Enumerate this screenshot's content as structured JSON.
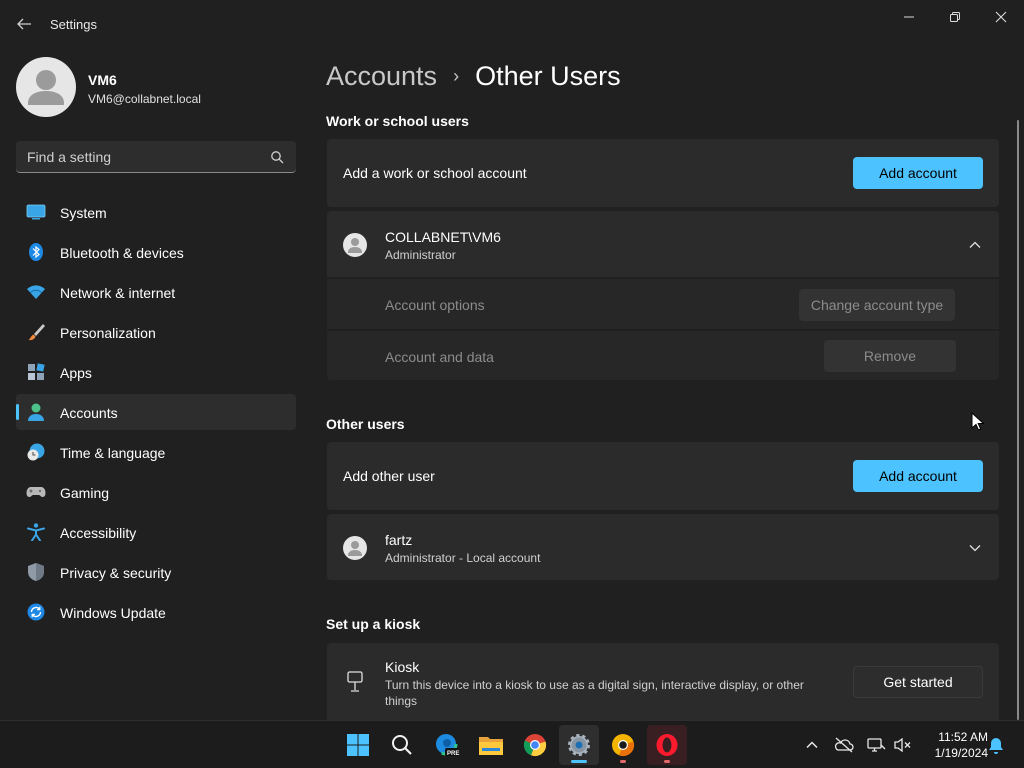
{
  "window": {
    "title": "Settings"
  },
  "profile": {
    "name": "VM6",
    "email": "VM6@collabnet.local"
  },
  "search": {
    "placeholder": "Find a setting"
  },
  "nav": {
    "items": [
      {
        "label": "System",
        "icon": "system-icon"
      },
      {
        "label": "Bluetooth & devices",
        "icon": "bluetooth-icon"
      },
      {
        "label": "Network & internet",
        "icon": "wifi-icon"
      },
      {
        "label": "Personalization",
        "icon": "brush-icon"
      },
      {
        "label": "Apps",
        "icon": "apps-icon"
      },
      {
        "label": "Accounts",
        "icon": "accounts-icon",
        "active": true
      },
      {
        "label": "Time & language",
        "icon": "globe-clock-icon"
      },
      {
        "label": "Gaming",
        "icon": "controller-icon"
      },
      {
        "label": "Accessibility",
        "icon": "accessibility-icon"
      },
      {
        "label": "Privacy & security",
        "icon": "shield-icon"
      },
      {
        "label": "Windows Update",
        "icon": "update-icon"
      }
    ]
  },
  "breadcrumb": {
    "parent": "Accounts",
    "separator": "›",
    "current": "Other Users"
  },
  "work_school": {
    "heading": "Work or school users",
    "add_label": "Add a work or school account",
    "add_button": "Add account",
    "user": {
      "name": "COLLABNET\\VM6",
      "role": "Administrator",
      "expanded": true
    },
    "options": {
      "account_options_label": "Account options",
      "change_type_button": "Change account type",
      "account_data_label": "Account and data",
      "remove_button": "Remove"
    }
  },
  "other_users": {
    "heading": "Other users",
    "add_label": "Add other user",
    "add_button": "Add account",
    "user": {
      "name": "fartz",
      "role": "Administrator - Local account",
      "expanded": false
    }
  },
  "kiosk": {
    "heading": "Set up a kiosk",
    "title": "Kiosk",
    "description": "Turn this device into a kiosk to use as a digital sign, interactive display, or other things",
    "button": "Get started"
  },
  "taskbar": {
    "apps": [
      "start-icon",
      "search-icon",
      "edge-beta-icon",
      "file-explorer-icon",
      "chrome-icon",
      "settings-icon",
      "chrome-canary-icon",
      "opera-icon"
    ],
    "edge_badge": "PRE",
    "time": "11:52 AM",
    "date": "1/19/2024"
  },
  "colors": {
    "accent": "#4cc2ff",
    "background": "#202020",
    "card": "#2b2b2b"
  }
}
